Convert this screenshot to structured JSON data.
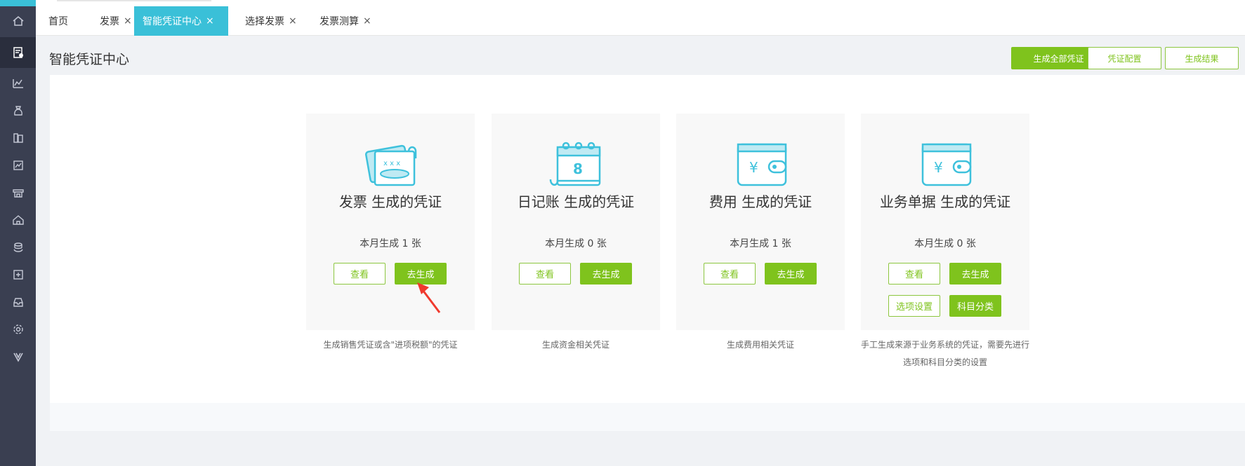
{
  "tabs": [
    {
      "label": "首页",
      "closable": false,
      "active": false
    },
    {
      "label": "发票",
      "closable": true,
      "active": false
    },
    {
      "label": "智能凭证中心",
      "closable": true,
      "active": true
    },
    {
      "label": "选择发票",
      "closable": true,
      "active": false
    },
    {
      "label": "发票测算",
      "closable": true,
      "active": false
    }
  ],
  "close_glyph": "×",
  "page": {
    "title": "智能凭证中心",
    "actions": {
      "generate_all": "生成全部凭证",
      "config": "凭证配置",
      "results": "生成结果"
    }
  },
  "cards": [
    {
      "title": "发票 生成的凭证",
      "count_text": "本月生成 1 张",
      "view": "查看",
      "generate": "去生成",
      "desc": "生成销售凭证或含\"进项税额\"的凭证",
      "icon": "invoice-icon"
    },
    {
      "title": "日记账 生成的凭证",
      "count_text": "本月生成 0 张",
      "view": "查看",
      "generate": "去生成",
      "desc": "生成资金相关凭证",
      "icon": "journal-calendar-icon"
    },
    {
      "title": "费用 生成的凭证",
      "count_text": "本月生成  1 张",
      "view": "查看",
      "generate": "去生成",
      "desc": "生成费用相关凭证",
      "icon": "wallet-yuan-icon"
    },
    {
      "title": "业务单据 生成的凭证",
      "count_text": "本月生成  0 张",
      "view": "查看",
      "generate": "去生成",
      "options": "选项设置",
      "classify": "科目分类",
      "desc": "手工生成来源于业务系统的凭证，需要先进行选项和科目分类的设置",
      "icon": "wallet-yuan-icon"
    }
  ],
  "sidebar": {
    "icons": [
      "home-icon",
      "voucher-icon",
      "chart-icon",
      "money-bag-icon",
      "books-icon",
      "report-icon",
      "shop-icon",
      "building-icon",
      "coins-icon",
      "document-add-icon",
      "inbox-icon",
      "settings-icon",
      "v-logo-icon"
    ]
  },
  "colors": {
    "accent": "#7fc31d",
    "tab_active": "#3ac0d8",
    "sidebar": "#3a3f51",
    "icon_cyan": "#3ec1dc"
  }
}
